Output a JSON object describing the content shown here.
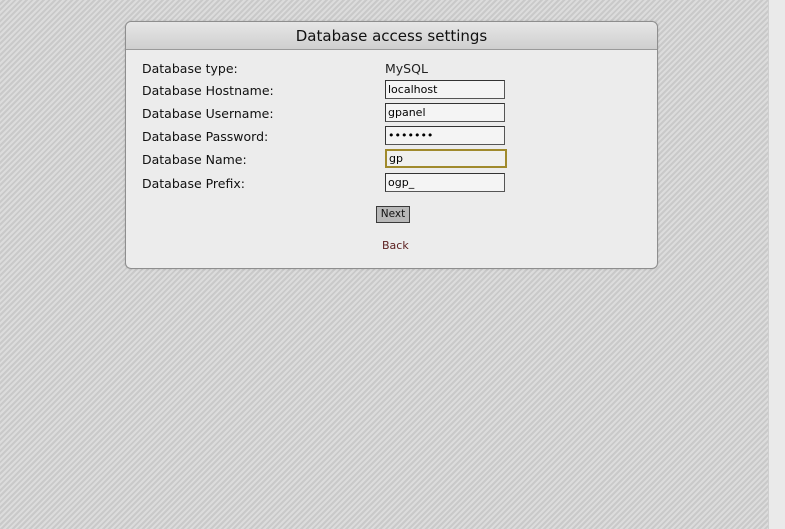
{
  "panel": {
    "title": "Database access settings"
  },
  "form": {
    "type_label": "Database type:",
    "type_value": "MySQL",
    "hostname_label": "Database Hostname:",
    "hostname_value": "localhost",
    "username_label": "Database Username:",
    "username_value": "gpanel",
    "password_label": "Database Password:",
    "password_value": "•••••••",
    "name_label": "Database Name:",
    "name_value": "gp",
    "prefix_label": "Database Prefix:",
    "prefix_value": "ogp_"
  },
  "actions": {
    "next_label": "Next",
    "back_label": "Back"
  }
}
